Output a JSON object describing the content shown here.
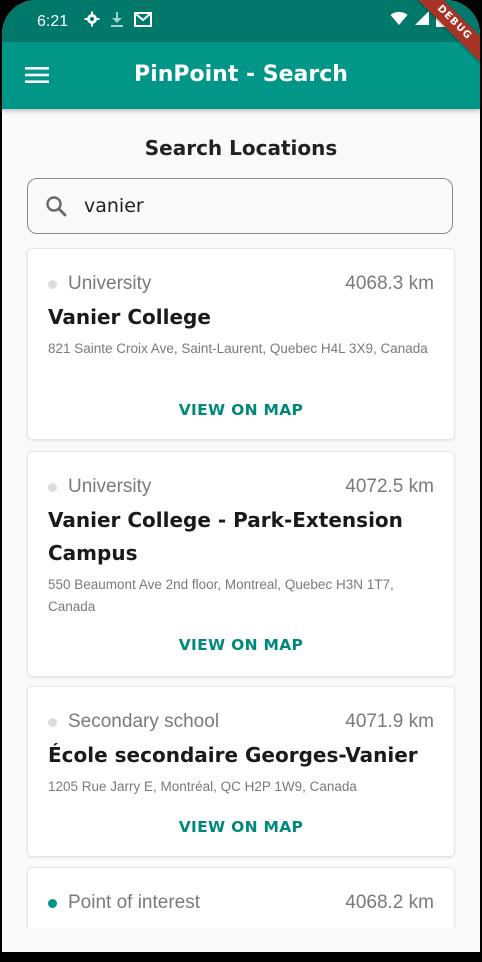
{
  "status_bar": {
    "time": "6:21",
    "left_icons": [
      "settings-icon",
      "download-icon",
      "gmail-icon"
    ],
    "right_icons": [
      "wifi-icon",
      "cell-signal-icon",
      "battery-icon"
    ]
  },
  "app_bar": {
    "menu_icon": "menu-icon",
    "title": "PinPoint - Search",
    "debug_banner": "DEBUG"
  },
  "page": {
    "heading": "Search Locations"
  },
  "search": {
    "icon": "search-icon",
    "value": "vanier",
    "placeholder": ""
  },
  "results": [
    {
      "category": "University",
      "distance": "4068.3 km",
      "name": "Vanier College",
      "address": "821 Sainte Croix Ave, Saint-Laurent, Quebec H4L 3X9, Canada",
      "action": "VIEW ON MAP",
      "active": false
    },
    {
      "category": "University",
      "distance": "4072.5 km",
      "name": "Vanier College - Park-Extension Campus",
      "address": "550 Beaumont Ave 2nd floor, Montreal, Quebec H3N 1T7, Canada",
      "action": "VIEW ON MAP",
      "active": false
    },
    {
      "category": "Secondary school",
      "distance": "4071.9 km",
      "name": "École secondaire Georges-Vanier",
      "address": "1205 Rue Jarry E, Montréal, QC H2P 1W9, Canada",
      "action": "VIEW ON MAP",
      "active": false
    },
    {
      "category": "Point of interest",
      "distance": "4068.2 km",
      "name": "",
      "address": "",
      "action": "",
      "active": true
    }
  ],
  "colors": {
    "status_bar": "#00796b",
    "app_bar": "#009688",
    "accent": "#00897b",
    "active_dot": "#009688",
    "inactive_dot": "#dddddd"
  }
}
